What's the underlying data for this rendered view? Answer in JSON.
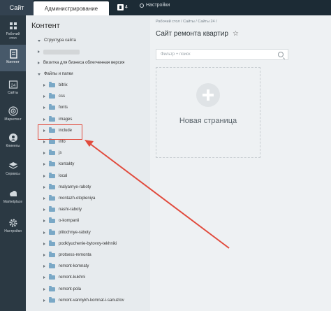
{
  "topbar": {
    "site_tab": "Сайт",
    "admin_tab": "Администрирование",
    "notifications_count": "4",
    "settings_label": "Настройки"
  },
  "sidebar": {
    "items": [
      {
        "label1": "Рабочий",
        "label2": "стол",
        "icon": "desktop-icon"
      },
      {
        "label1": "Контент",
        "label2": "",
        "icon": "content-icon"
      },
      {
        "label1": "Сайты",
        "label2": "",
        "icon": "calendar-24-icon"
      },
      {
        "label1": "Маркетинг",
        "label2": "",
        "icon": "target-icon"
      },
      {
        "label1": "Клиенты",
        "label2": "",
        "icon": "clients-icon"
      },
      {
        "label1": "Сервисы",
        "label2": "",
        "icon": "layers-icon"
      },
      {
        "label1": "Marketplace",
        "label2": "",
        "icon": "cloud-icon"
      },
      {
        "label1": "Настройки",
        "label2": "",
        "icon": "gear-icon"
      }
    ]
  },
  "tree": {
    "title": "Контент",
    "structure": "Структура сайта",
    "business": "Визитка для бизнеса облегченная версия",
    "files": "Файлы и папки",
    "folders": [
      "bitrix",
      "css",
      "fonts",
      "images",
      "include",
      "info",
      "js",
      "kontakty",
      "local",
      "malyarnye-raboty",
      "montazh-otopleniya",
      "nashi-raboty",
      "o-kompanii",
      "plitochnye-raboty",
      "podklyuchenie-bytovoy-tekhniki",
      "protsess-remonta",
      "remont-komnaty",
      "remont-kukhni",
      "remont-pola",
      "remont-vannykh-komnat-i-sanuzlov"
    ]
  },
  "main": {
    "breadcrumb": "Рабочий стол  /  Сайты  /  Сайты 24  /",
    "title": "Сайт ремонта квартир",
    "filter_placeholder": "Фильтр + поиск",
    "new_page": "Новая страница"
  },
  "colors": {
    "topbar": "#1c2b35",
    "sidebar": "#2b3943",
    "tree_bg": "#e7ebee",
    "highlight": "#e14b3d"
  }
}
